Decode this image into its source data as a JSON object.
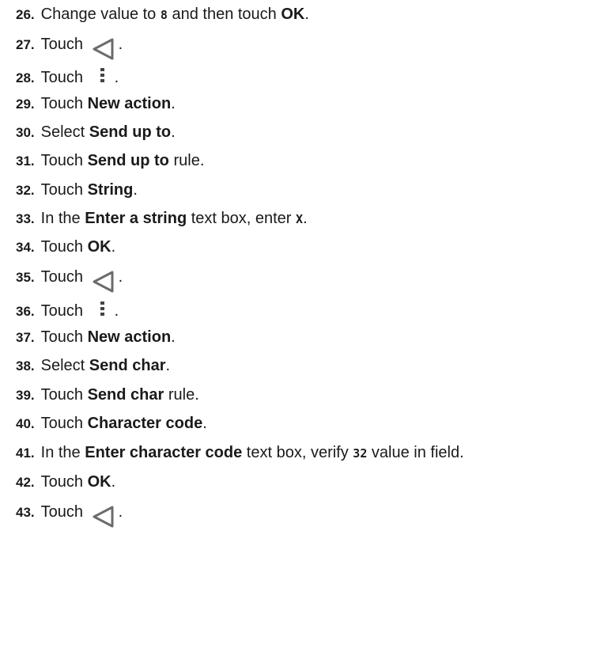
{
  "steps": [
    {
      "num": "26.",
      "parts": [
        {
          "t": "text",
          "v": "Change value to "
        },
        {
          "t": "code",
          "v": "8"
        },
        {
          "t": "text",
          "v": " and then touch "
        },
        {
          "t": "bold",
          "v": "OK"
        },
        {
          "t": "text",
          "v": "."
        }
      ]
    },
    {
      "num": "27.",
      "parts": [
        {
          "t": "text",
          "v": "Touch "
        },
        {
          "t": "icon",
          "icon": "back-triangle-icon"
        },
        {
          "t": "text",
          "v": "."
        }
      ]
    },
    {
      "num": "28.",
      "parts": [
        {
          "t": "text",
          "v": "Touch "
        },
        {
          "t": "icon",
          "icon": "overflow-menu-icon"
        },
        {
          "t": "text",
          "v": "."
        }
      ]
    },
    {
      "num": "29.",
      "parts": [
        {
          "t": "text",
          "v": "Touch "
        },
        {
          "t": "bold",
          "v": "New action"
        },
        {
          "t": "text",
          "v": "."
        }
      ]
    },
    {
      "num": "30.",
      "parts": [
        {
          "t": "text",
          "v": "Select "
        },
        {
          "t": "bold",
          "v": "Send up to"
        },
        {
          "t": "text",
          "v": "."
        }
      ]
    },
    {
      "num": "31.",
      "parts": [
        {
          "t": "text",
          "v": "Touch "
        },
        {
          "t": "bold",
          "v": "Send up to"
        },
        {
          "t": "text",
          "v": " rule."
        }
      ]
    },
    {
      "num": "32.",
      "parts": [
        {
          "t": "text",
          "v": "Touch "
        },
        {
          "t": "bold",
          "v": "String"
        },
        {
          "t": "text",
          "v": "."
        }
      ]
    },
    {
      "num": "33.",
      "parts": [
        {
          "t": "text",
          "v": "In the "
        },
        {
          "t": "bold",
          "v": "Enter a string"
        },
        {
          "t": "text",
          "v": " text box, enter "
        },
        {
          "t": "code",
          "v": "X"
        },
        {
          "t": "text",
          "v": "."
        }
      ]
    },
    {
      "num": "34.",
      "parts": [
        {
          "t": "text",
          "v": "Touch "
        },
        {
          "t": "bold",
          "v": "OK"
        },
        {
          "t": "text",
          "v": "."
        }
      ]
    },
    {
      "num": "35.",
      "parts": [
        {
          "t": "text",
          "v": "Touch "
        },
        {
          "t": "icon",
          "icon": "back-triangle-icon"
        },
        {
          "t": "text",
          "v": "."
        }
      ]
    },
    {
      "num": "36.",
      "parts": [
        {
          "t": "text",
          "v": "Touch "
        },
        {
          "t": "icon",
          "icon": "overflow-menu-icon"
        },
        {
          "t": "text",
          "v": "."
        }
      ]
    },
    {
      "num": "37.",
      "parts": [
        {
          "t": "text",
          "v": "Touch "
        },
        {
          "t": "bold",
          "v": "New action"
        },
        {
          "t": "text",
          "v": "."
        }
      ]
    },
    {
      "num": "38.",
      "parts": [
        {
          "t": "text",
          "v": "Select "
        },
        {
          "t": "bold",
          "v": "Send char"
        },
        {
          "t": "text",
          "v": "."
        }
      ]
    },
    {
      "num": "39.",
      "parts": [
        {
          "t": "text",
          "v": "Touch "
        },
        {
          "t": "bold",
          "v": "Send char"
        },
        {
          "t": "text",
          "v": " rule."
        }
      ]
    },
    {
      "num": "40.",
      "parts": [
        {
          "t": "text",
          "v": "Touch "
        },
        {
          "t": "bold",
          "v": "Character code"
        },
        {
          "t": "text",
          "v": "."
        }
      ]
    },
    {
      "num": "41.",
      "parts": [
        {
          "t": "text",
          "v": "In the "
        },
        {
          "t": "bold",
          "v": "Enter character code"
        },
        {
          "t": "text",
          "v": " text box, verify "
        },
        {
          "t": "code",
          "v": "32"
        },
        {
          "t": "text",
          "v": " value in field."
        }
      ]
    },
    {
      "num": "42.",
      "parts": [
        {
          "t": "text",
          "v": "Touch "
        },
        {
          "t": "bold",
          "v": "OK"
        },
        {
          "t": "text",
          "v": "."
        }
      ]
    },
    {
      "num": "43.",
      "parts": [
        {
          "t": "text",
          "v": "Touch "
        },
        {
          "t": "icon",
          "icon": "back-triangle-icon"
        },
        {
          "t": "text",
          "v": "."
        }
      ]
    }
  ]
}
